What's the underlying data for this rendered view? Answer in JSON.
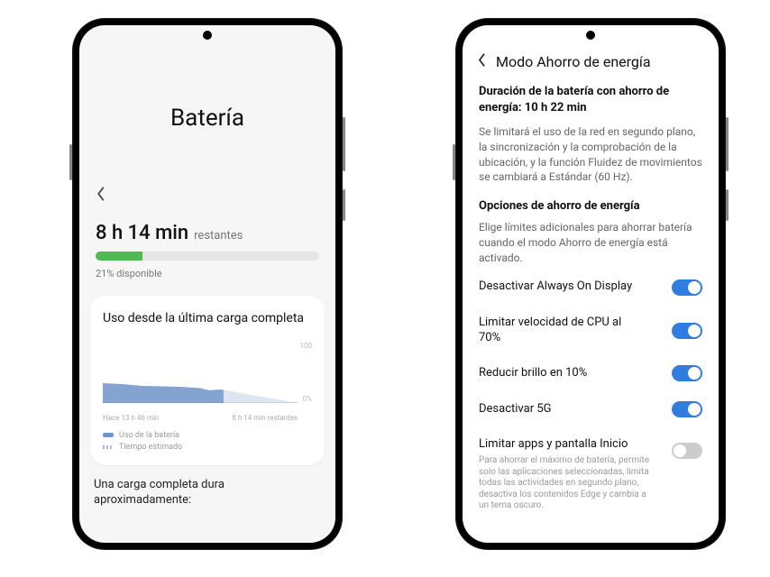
{
  "screen1": {
    "title": "Batería",
    "remaining_time": "8 h 14 min",
    "remaining_suffix": "restantes",
    "available": "21% disponible",
    "card_title": "Uso desde la última carga completa",
    "x_left": "Hace 13 h 46 min",
    "x_right": "8 h 14 min restantes",
    "legend_usage": "Uso de la batería",
    "legend_est": "Tiempo estimado",
    "y100": "100",
    "y0": "0%",
    "footer": "Una carga completa dura aproximadamente:"
  },
  "chart_data": {
    "type": "area",
    "title": "Uso desde la última carga completa",
    "xlabel": "",
    "ylabel": "%",
    "ylim": [
      0,
      100
    ],
    "series": [
      {
        "name": "Uso de la batería",
        "x": [
          0,
          10,
          20,
          30,
          40,
          50,
          55,
          60,
          62
        ],
        "values": [
          32,
          30,
          28,
          27,
          26,
          24,
          20,
          22,
          21
        ]
      },
      {
        "name": "Tiempo estimado",
        "x": [
          62,
          100
        ],
        "values": [
          21,
          0
        ]
      }
    ],
    "x_left_label": "Hace 13 h 46 min",
    "x_right_label": "8 h 14 min restantes"
  },
  "screen2": {
    "title": "Modo Ahorro de energía",
    "duration_label": "Duración de la batería con ahorro de energía: 10 h 22 min",
    "duration_desc": "Se limitará el uso de la red en segundo plano, la sincronización y la comprobación de la ubicación, y la función Fluidez de movimientos se cambiará a Estándar (60 Hz).",
    "section": "Opciones de ahorro de energía",
    "section_desc": "Elige límites adicionales para ahorrar batería cuando el modo Ahorro de energía está activado.",
    "rows": [
      {
        "label": "Desactivar Always On Display",
        "sub": "",
        "on": true
      },
      {
        "label": "Limitar velocidad de CPU al 70%",
        "sub": "",
        "on": true
      },
      {
        "label": "Reducir brillo en 10%",
        "sub": "",
        "on": true
      },
      {
        "label": "Desactivar 5G",
        "sub": "",
        "on": true
      },
      {
        "label": "Limitar apps y pantalla Inicio",
        "sub": "Para ahorrar el máximo de batería, permite solo las aplicaciones seleccionadas, limita todas las actividades en segundo plano, desactiva los contenidos Edge y cambia a un tema oscuro.",
        "on": false
      }
    ]
  }
}
